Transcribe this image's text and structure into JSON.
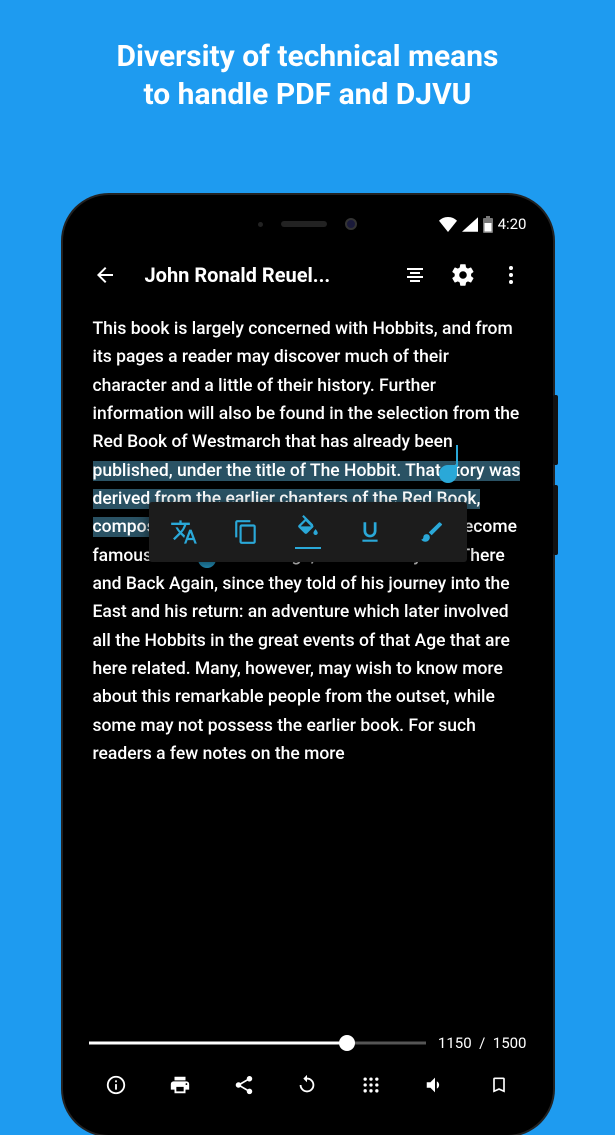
{
  "promo": {
    "line1": "Diversity of technical means",
    "line2": "to handle PDF and DJVU"
  },
  "status": {
    "time": "4:20"
  },
  "appbar": {
    "title": "John Ronald Reuel..."
  },
  "document": {
    "text_before": "This book is largely concerned with Hobbits, and from its pages a reader may discover much of their character and a little of their history. Further information will also be found in the selection from the Red Book of Westmarch that has already been ",
    "text_selected": "published, under the title of The Hobbit. That story was derived from the earlier chapters of the Red Book, composed by",
    "text_after": " Bilbo himself, the first Hobbit to become famous in the world at large, and called by him There and Back Again, since they told of his journey into the East and his return: an adventure which later involved all the Hobbits in the great events of that Age that are here related. Many, however, may wish to know more about this remarkable people from the outset, while some may not possess the earlier book. For such readers a few notes on the more"
  },
  "progress": {
    "current": "1150",
    "separator": "/",
    "total": "1500",
    "percent": 76.7
  },
  "icons": {
    "back": "back-arrow",
    "align": "text-align",
    "settings": "gear",
    "more": "more-vertical",
    "translate": "translate",
    "copy": "copy",
    "highlight": "paint-bucket",
    "underline": "underline",
    "draw": "brush",
    "info": "info",
    "print": "print",
    "share": "share",
    "reload": "refresh",
    "grid": "grid",
    "volume": "volume",
    "bookmark": "bookmark"
  }
}
